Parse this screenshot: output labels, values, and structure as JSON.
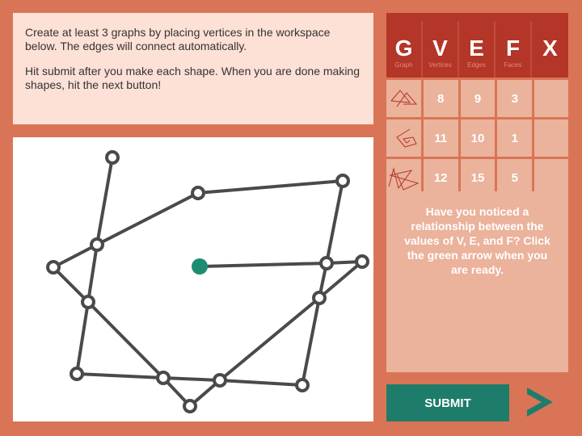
{
  "instructions": {
    "p1": "Create at least 3 graphs by placing vertices in the workspace below. The edges will connect automatically.",
    "p2": "Hit submit after you make each shape. When you are done making shapes, hit the next button!"
  },
  "table": {
    "headers": [
      {
        "letter": "G",
        "label": "Graph"
      },
      {
        "letter": "V",
        "label": "Vertices"
      },
      {
        "letter": "E",
        "label": "Edges"
      },
      {
        "letter": "F",
        "label": "Faces"
      },
      {
        "letter": "X",
        "label": ""
      }
    ],
    "rows": [
      {
        "thumb": "graph-1-thumbnail",
        "v": "8",
        "e": "9",
        "f": "3",
        "x": ""
      },
      {
        "thumb": "graph-2-thumbnail",
        "v": "11",
        "e": "10",
        "f": "1",
        "x": ""
      },
      {
        "thumb": "graph-3-thumbnail",
        "v": "12",
        "e": "15",
        "f": "5",
        "x": ""
      }
    ]
  },
  "message": "Have you noticed a relationship between the values of V, E, and F? Click the green arrow when you are ready.",
  "submit_label": "SUBMIT",
  "colors": {
    "accent": "#1e7d6a",
    "header": "#b33628",
    "background": "#d97556"
  }
}
